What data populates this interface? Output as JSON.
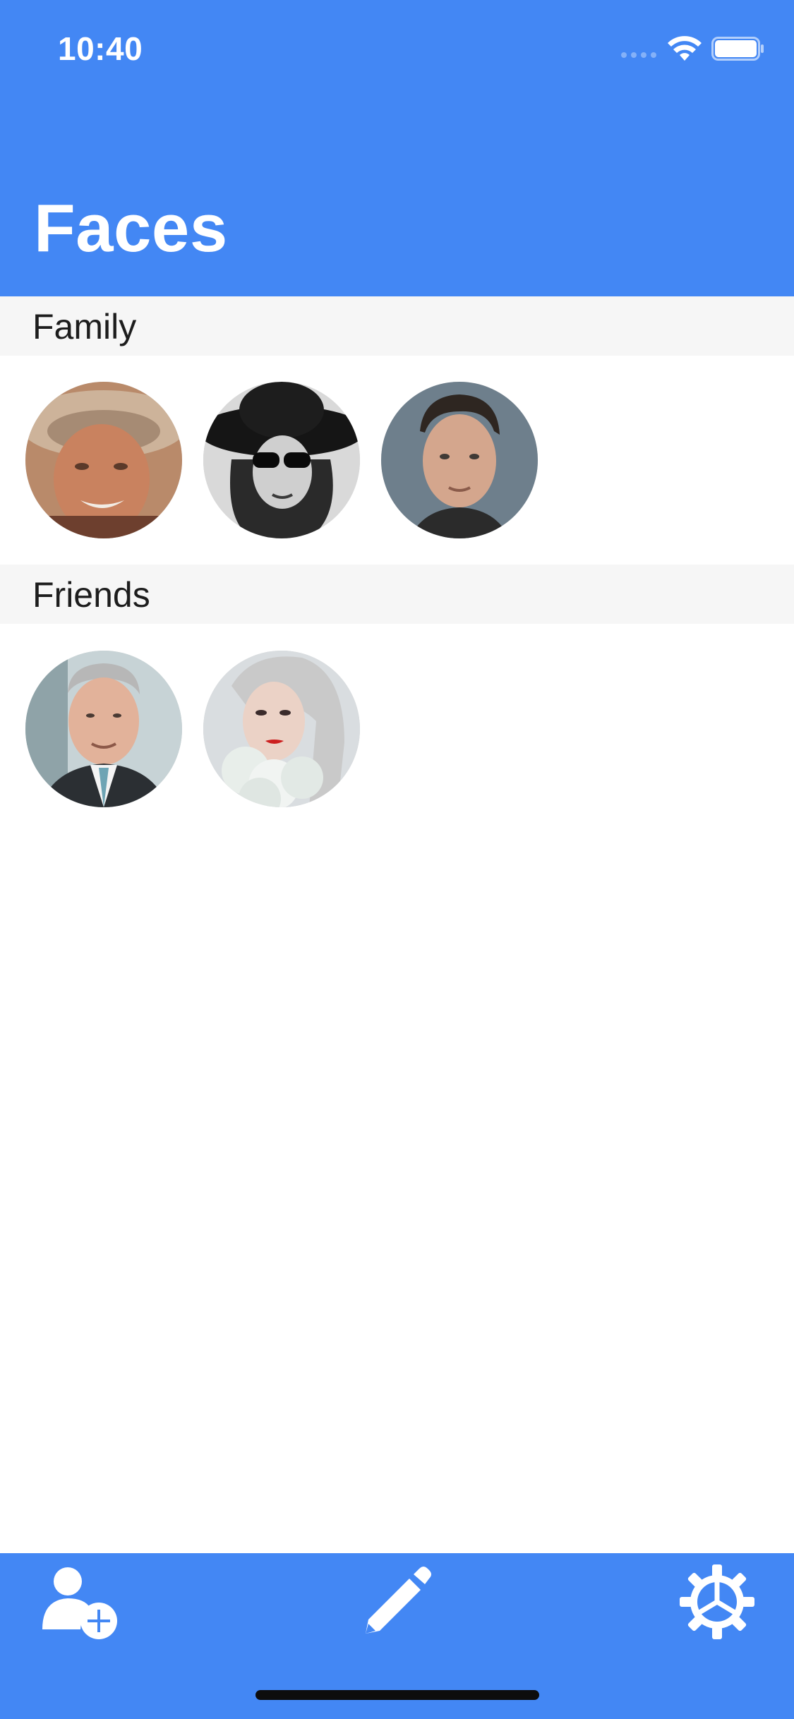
{
  "status_bar": {
    "time": "10:40"
  },
  "header": {
    "title": "Faces",
    "background": "#4387F4"
  },
  "sections": [
    {
      "label": "Family",
      "faces": [
        {
          "name": "family-face-1",
          "icon": "portrait-photo"
        },
        {
          "name": "family-face-2",
          "icon": "portrait-photo"
        },
        {
          "name": "family-face-3",
          "icon": "portrait-photo"
        }
      ]
    },
    {
      "label": "Friends",
      "faces": [
        {
          "name": "friends-face-1",
          "icon": "portrait-photo"
        },
        {
          "name": "friends-face-2",
          "icon": "portrait-photo"
        }
      ]
    }
  ],
  "toolbar": {
    "background": "#4387F4",
    "buttons": [
      {
        "icon": "add-person-icon"
      },
      {
        "icon": "pencil-icon"
      },
      {
        "icon": "gear-icon"
      }
    ]
  }
}
